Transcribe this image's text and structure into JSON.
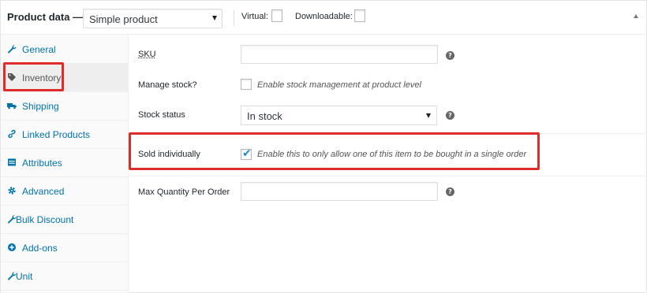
{
  "header": {
    "title": "Product data —",
    "product_type": "Simple product",
    "virtual_label": "Virtual:",
    "downloadable_label": "Downloadable:"
  },
  "tabs": [
    {
      "label": "General",
      "icon": "wrench-icon"
    },
    {
      "label": "Inventory",
      "icon": "tag-icon",
      "active": true
    },
    {
      "label": "Shipping",
      "icon": "truck-icon"
    },
    {
      "label": "Linked Products",
      "icon": "link-icon"
    },
    {
      "label": "Attributes",
      "icon": "table-icon"
    },
    {
      "label": "Advanced",
      "icon": "gear-icon"
    },
    {
      "label": "Bulk Discount",
      "icon": "wrench-icon"
    },
    {
      "label": "Add-ons",
      "icon": "plus-circle-icon"
    },
    {
      "label": "Unit",
      "icon": "wrench-icon"
    }
  ],
  "fields": {
    "sku": {
      "label": "SKU",
      "value": ""
    },
    "manage_stock": {
      "label": "Manage stock?",
      "description": "Enable stock management at product level",
      "checked": false
    },
    "stock_status": {
      "label": "Stock status",
      "value": "In stock"
    },
    "sold_individually": {
      "label": "Sold individually",
      "description": "Enable this to only allow one of this item to be bought in a single order",
      "checked": true
    },
    "max_qty": {
      "label": "Max Quantity Per Order",
      "value": ""
    }
  },
  "help_glyph": "?",
  "check_glyph": "✔",
  "colors": {
    "accent": "#0073aa",
    "highlight": "#e02b2b",
    "checkmark": "#1e8cbe"
  }
}
